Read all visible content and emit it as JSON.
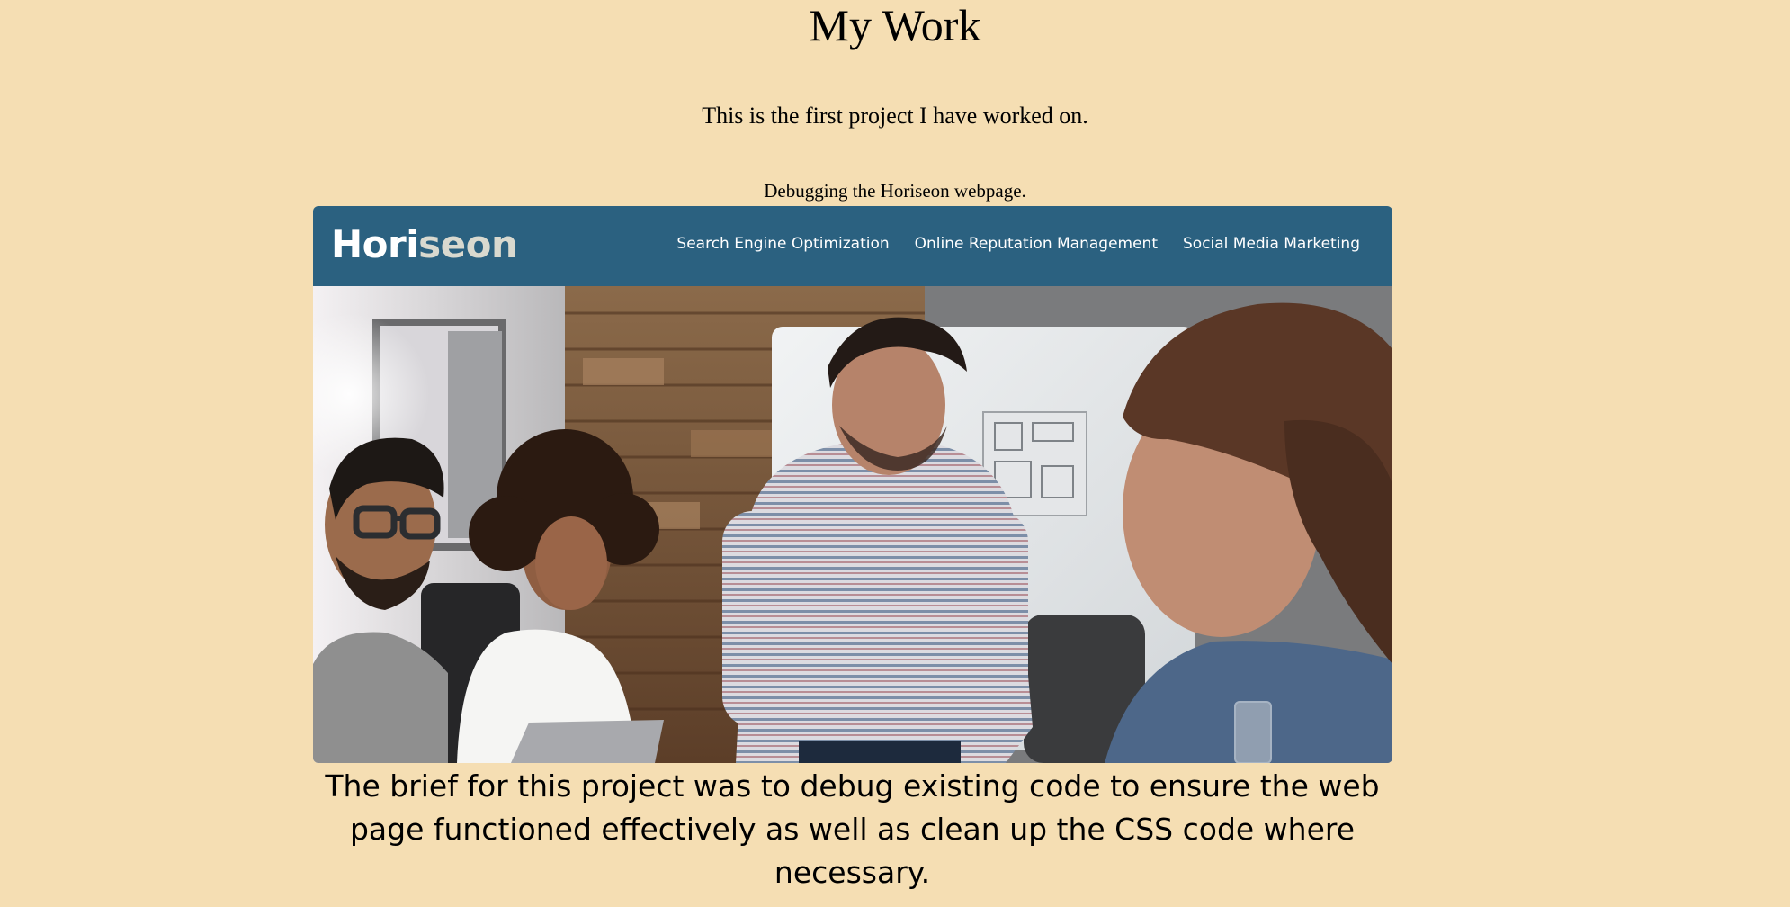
{
  "page": {
    "title": "My Work",
    "intro": "This is the first project I have worked on.",
    "project_caption": "Debugging the Horiseon webpage.",
    "project_description": "The brief for this project was to debug existing code to ensure the web page functioned effectively as well as clean up the CSS code where necessary."
  },
  "screenshot": {
    "logo_part1": "Hori",
    "logo_part2": "seon",
    "nav": [
      "Search Engine Optimization",
      "Online Reputation Management",
      "Social Media Marketing"
    ]
  },
  "colors": {
    "background": "#f5deb3",
    "header": "#2b6180",
    "logo_accent": "#d9d9cf"
  }
}
